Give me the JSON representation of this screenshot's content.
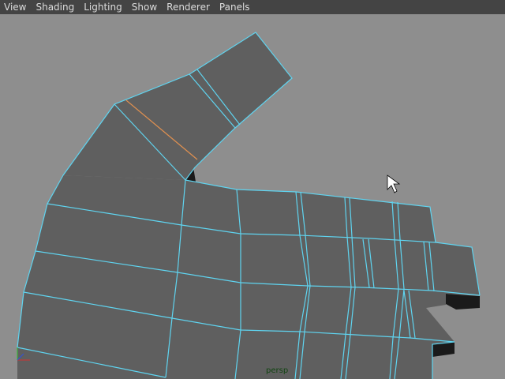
{
  "menubar": {
    "items": [
      "View",
      "Shading",
      "Lighting",
      "Show",
      "Renderer",
      "Panels"
    ]
  },
  "viewport": {
    "camera_label": "persp",
    "background": "#8e8e8e",
    "mesh_face_color": "#5f5f5f",
    "mesh_side_color": "#1a1a1a",
    "wire_color": "#5fd4f0",
    "selected_edge_color": "#e09050"
  },
  "axis_gizmo": {
    "x_color": "#d03030",
    "y_color": "#30c030",
    "z_color": "#3050e0"
  },
  "cursor": {
    "icon": "arrow-cursor-icon"
  }
}
